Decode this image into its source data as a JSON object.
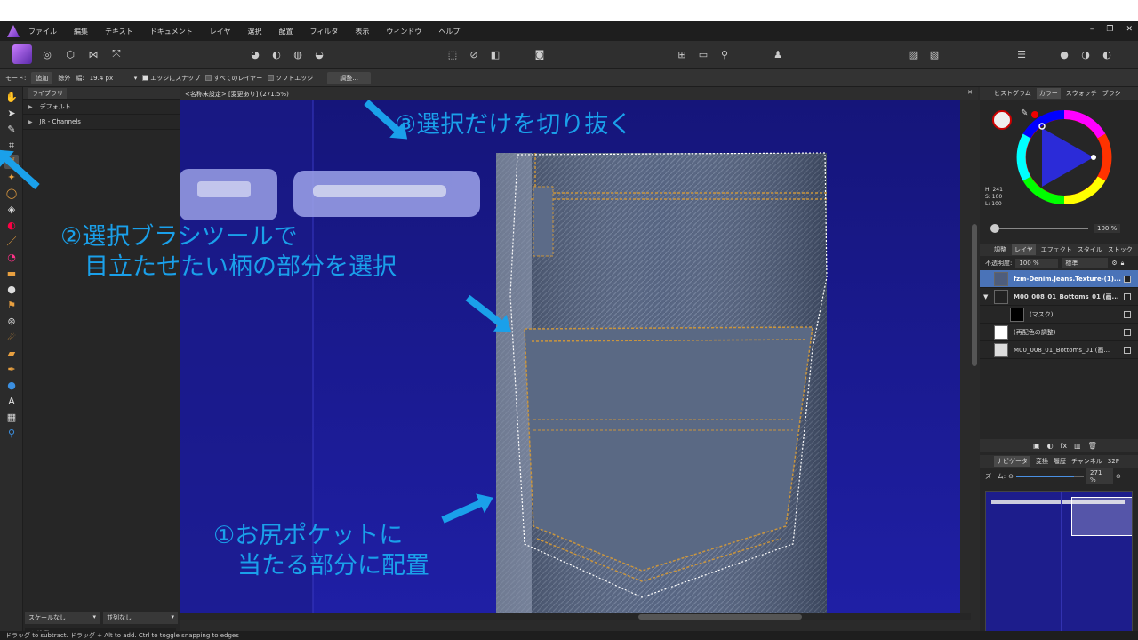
{
  "menu": [
    "ファイル",
    "編集",
    "テキスト",
    "ドキュメント",
    "レイヤ",
    "選択",
    "配置",
    "フィルタ",
    "表示",
    "ウィンドウ",
    "ヘルプ"
  ],
  "context_bar": {
    "mode_label": "モード:",
    "add": "追加",
    "remove": "除外",
    "width_label": "幅:",
    "width_value": "19.4 px",
    "snap_edges": "エッジにスナップ",
    "all_layers": "すべてのレイヤー",
    "soft_edges": "ソフトエッジ",
    "refine": "調整..."
  },
  "left_panel": {
    "tab": "ライブラリ",
    "rows": [
      "デフォルト",
      "JR - Channels"
    ],
    "scale": "スケールなし",
    "sort": "並列なし",
    "search_placeholder": "検索"
  },
  "document_tab": "<名称未設定> [変更あり] (271.5%)",
  "color_panel": {
    "tabs": [
      "ヒストグラム",
      "カラー",
      "スウォッチ",
      "ブラシ"
    ],
    "h": "H: 241",
    "s": "S: 100",
    "l": "L: 100",
    "opacity": "100 %"
  },
  "layers_panel": {
    "tabs": [
      "調整",
      "レイヤ",
      "エフェクト",
      "スタイル",
      "ストック"
    ],
    "opacity_label": "不透明度:",
    "opacity": "100 %",
    "blend": "標準",
    "layers": [
      "fzm-Denim.Jeans.Texture-(1)...",
      "M00_008_01_Bottoms_01 (画...",
      "(マスク)",
      "(再配色の調整)",
      "M00_008_01_Bottoms_01 (画..."
    ]
  },
  "navigator_panel": {
    "tabs": [
      "ナビゲータ",
      "変換",
      "履歴",
      "チャンネル",
      "32P"
    ],
    "zoom_label": "ズーム:",
    "zoom": "271 %",
    "zoom_fraction": 0.85
  },
  "status_text": "ドラッグ to subtract. ドラッグ + Alt to add. Ctrl to toggle snapping to edges",
  "annotations": {
    "a1": "①お尻ポケットに\n　当たる部分に配置",
    "a2": "②選択ブラシツールで\n　目立たせたい柄の部分を選択",
    "a3": "③選択だけを切り抜く"
  },
  "colors": {
    "accent": "#1aa0ea",
    "canvas_bg": "#191970",
    "selection": "#4a73b8"
  }
}
